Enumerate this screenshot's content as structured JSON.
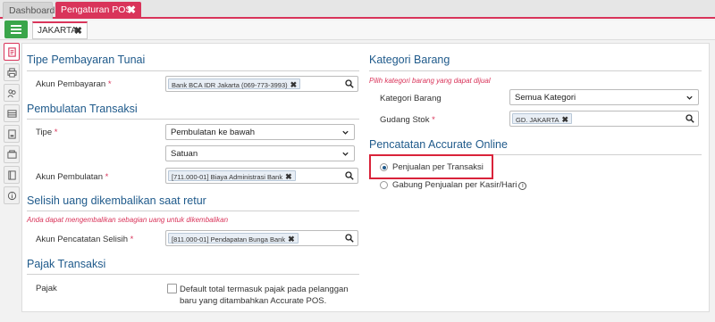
{
  "tabs": [
    {
      "label": "Dashboard"
    },
    {
      "label": "Pengaturan POS",
      "close": "✖"
    }
  ],
  "subtab": {
    "label": "JAKARTA",
    "close": "✖"
  },
  "sidebar_icons": [
    "settings-doc-icon",
    "printer-icon",
    "people-icon",
    "table-icon",
    "report-icon",
    "register-icon",
    "book-icon",
    "info-icon"
  ],
  "left": {
    "cash_payment": {
      "title": "Tipe Pembayaran Tunai",
      "account_label": "Akun Pembayaran",
      "account_value": "Bank BCA IDR Jakarta (069-773-3993)"
    },
    "rounding": {
      "title": "Pembulatan Transaksi",
      "type_label": "Tipe",
      "type_value": "Pembulatan ke bawah",
      "unit_value": "Satuan",
      "account_label": "Akun Pembulatan",
      "account_value": "[711.000-01] Biaya Administrasi Bank"
    },
    "return_diff": {
      "title": "Selisih uang dikembalikan saat retur",
      "note": "Anda dapat mengembalikan sebagian uang untuk dikembalikan",
      "account_label": "Akun Pencatatan Selisih",
      "account_value": "[811.000-01] Pendapatan Bunga Bank"
    },
    "tax": {
      "title": "Pajak Transaksi",
      "label": "Pajak",
      "checkbox_line1": "Default total termasuk pajak pada pelanggan",
      "checkbox_line2": "baru yang ditambahkan Accurate POS."
    }
  },
  "right": {
    "category": {
      "title": "Kategori Barang",
      "note": "Pilih kategori barang yang dapat dijual",
      "category_label": "Kategori Barang",
      "category_value": "Semua Kategori",
      "warehouse_label": "Gudang Stok",
      "warehouse_value": "GD. JAKARTA"
    },
    "recording": {
      "title": "Pencatatan Accurate Online",
      "option1": "Penjualan per Transaksi",
      "option2": "Gabung Penjualan per Kasir/Hari",
      "selected": "option1"
    }
  },
  "req_mark": "*",
  "tag_remove": "✖",
  "info_glyph": "i",
  "colors": {
    "accent": "#d9345a",
    "title_blue": "#1f5a8b",
    "menu_green": "#3aa54a",
    "highlight_red": "#d9233a"
  }
}
